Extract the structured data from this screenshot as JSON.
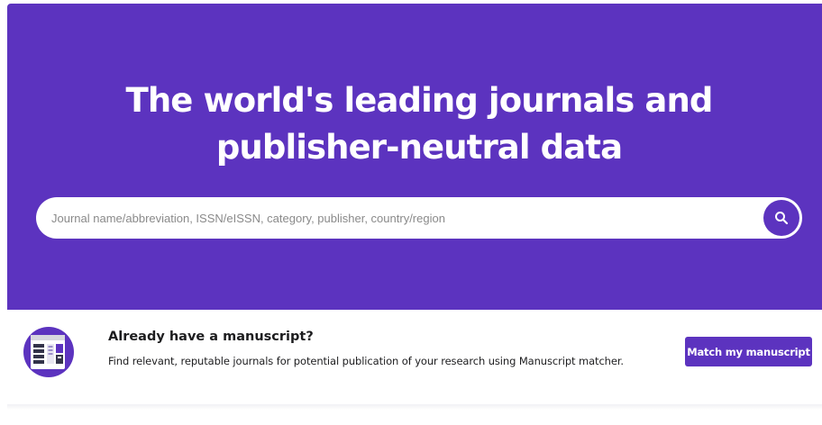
{
  "hero": {
    "title": "The world's leading journals and publisher-neutral data",
    "background_color": "#5c33bf"
  },
  "search": {
    "placeholder": "Journal name/abbreviation, ISSN/eISSN, category, publisher, country/region",
    "value": "",
    "button_icon": "search-icon"
  },
  "manuscript_banner": {
    "icon": "manuscript-illustration-icon",
    "heading": "Already have a manuscript?",
    "description": "Find relevant, reputable journals for potential publication of your research using Manuscript matcher.",
    "button_label": "Match my manuscript"
  },
  "colors": {
    "accent": "#5c33bf",
    "text": "#1d1d1f"
  }
}
